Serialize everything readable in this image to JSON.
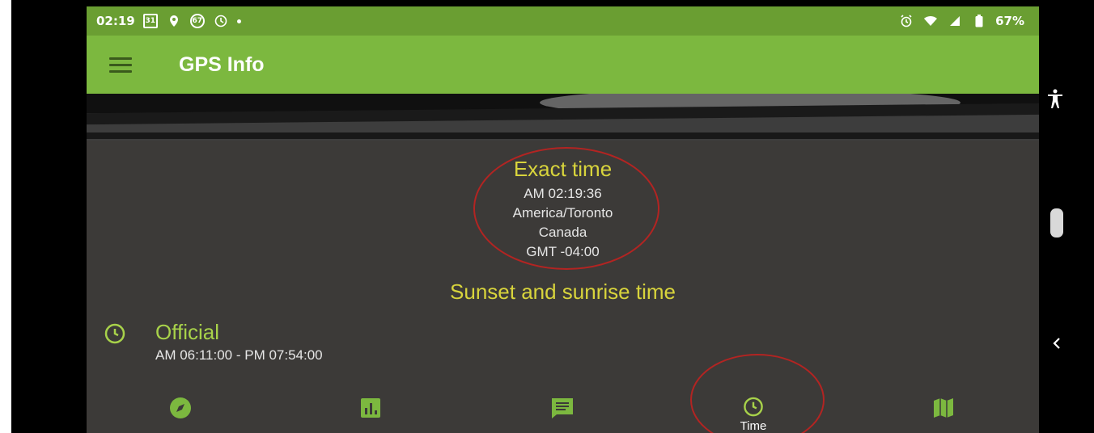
{
  "status_bar": {
    "time": "02:19",
    "calendar_badge": "31",
    "notification_badge": "67",
    "battery_percent": "67%",
    "icons": [
      "calendar-icon",
      "location-pin-icon",
      "badge-icon",
      "clock-icon",
      "dot-icon",
      "alarm-icon",
      "wifi-icon",
      "signal-icon",
      "battery-icon"
    ]
  },
  "app_bar": {
    "title": "GPS Info"
  },
  "exact_time": {
    "title": "Exact time",
    "time": "AM 02:19:36",
    "timezone": "America/Toronto",
    "country": "Canada",
    "offset": "GMT -04:00"
  },
  "sun_section": {
    "title": "Sunset and sunrise time",
    "official_label": "Official",
    "official_range": "AM 06:11:00 - PM 07:54:00"
  },
  "bottom_nav": {
    "items": [
      {
        "icon": "compass-icon",
        "label": ""
      },
      {
        "icon": "bar-chart-icon",
        "label": ""
      },
      {
        "icon": "message-icon",
        "label": ""
      },
      {
        "icon": "clock-icon",
        "label": "Time"
      },
      {
        "icon": "map-icon",
        "label": ""
      }
    ]
  },
  "side_nav": {
    "icons": [
      "accessibility-icon",
      "scroll-handle",
      "back-icon"
    ]
  },
  "colors": {
    "status_bar": "#6a9e32",
    "app_bar": "#7cb83f",
    "background": "#3c3a38",
    "accent_yellow": "#d8d43c",
    "accent_green": "#a8d24a",
    "annotation_red": "#b32422"
  }
}
